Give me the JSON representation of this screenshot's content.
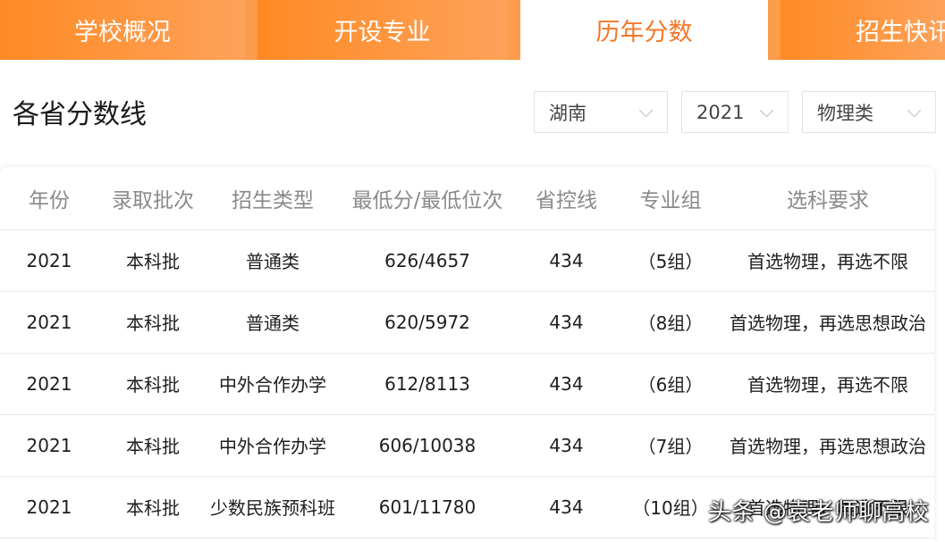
{
  "tabs": [
    {
      "label": "学校概况"
    },
    {
      "label": "开设专业"
    },
    {
      "label": "历年分数"
    },
    {
      "label": "招生快讯"
    }
  ],
  "section": {
    "title": "各省分数线"
  },
  "filters": [
    {
      "value": "湖南"
    },
    {
      "value": "2021"
    },
    {
      "value": "物理类"
    }
  ],
  "table": {
    "headers": [
      "年份",
      "录取批次",
      "招生类型",
      "最低分/最低位次",
      "省控线",
      "专业组",
      "选科要求"
    ],
    "rows": [
      [
        "2021",
        "本科批",
        "普通类",
        "626/4657",
        "434",
        "（5组）",
        "首选物理，再选不限"
      ],
      [
        "2021",
        "本科批",
        "普通类",
        "620/5972",
        "434",
        "（8组）",
        "首选物理，再选思想政治"
      ],
      [
        "2021",
        "本科批",
        "中外合作办学",
        "612/8113",
        "434",
        "（6组）",
        "首选物理，再选不限"
      ],
      [
        "2021",
        "本科批",
        "中外合作办学",
        "606/10038",
        "434",
        "（7组）",
        "首选物理，再选思想政治"
      ],
      [
        "2021",
        "本科批",
        "少数民族预科班",
        "601/11780",
        "434",
        "（10组）",
        "首选物理，再选不限"
      ]
    ]
  },
  "watermark": "头条 @袁老师聊高校",
  "colors": {
    "accent": "#f4782a",
    "tab_bg": "#fb9d4a"
  }
}
